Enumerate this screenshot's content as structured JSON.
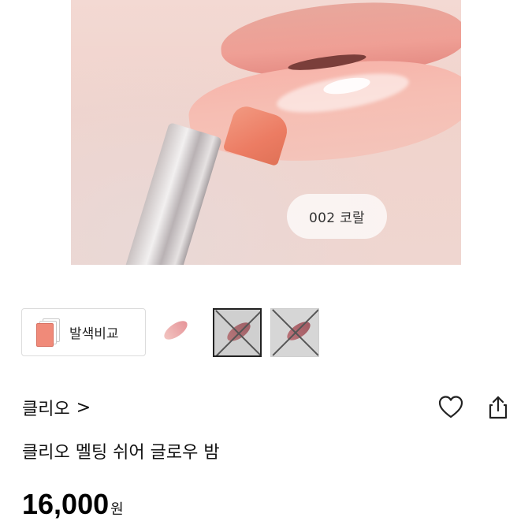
{
  "hero": {
    "shade_label": "002 코랄"
  },
  "options": {
    "compare_label": "발색비교",
    "thumbnails": [
      {
        "name": "shade-1",
        "sold_out": false
      },
      {
        "name": "shade-2",
        "sold_out": true
      },
      {
        "name": "shade-3",
        "sold_out": true
      }
    ]
  },
  "product": {
    "brand": "클리오",
    "brand_chevron": ">",
    "title": "클리오 멜팅 쉬어 글로우 밤",
    "price": "16,000",
    "currency": "원"
  },
  "icons": {
    "wishlist": "heart-icon",
    "share": "share-icon"
  },
  "colors": {
    "accent_coral": "#ec7c63",
    "text": "#111111"
  }
}
